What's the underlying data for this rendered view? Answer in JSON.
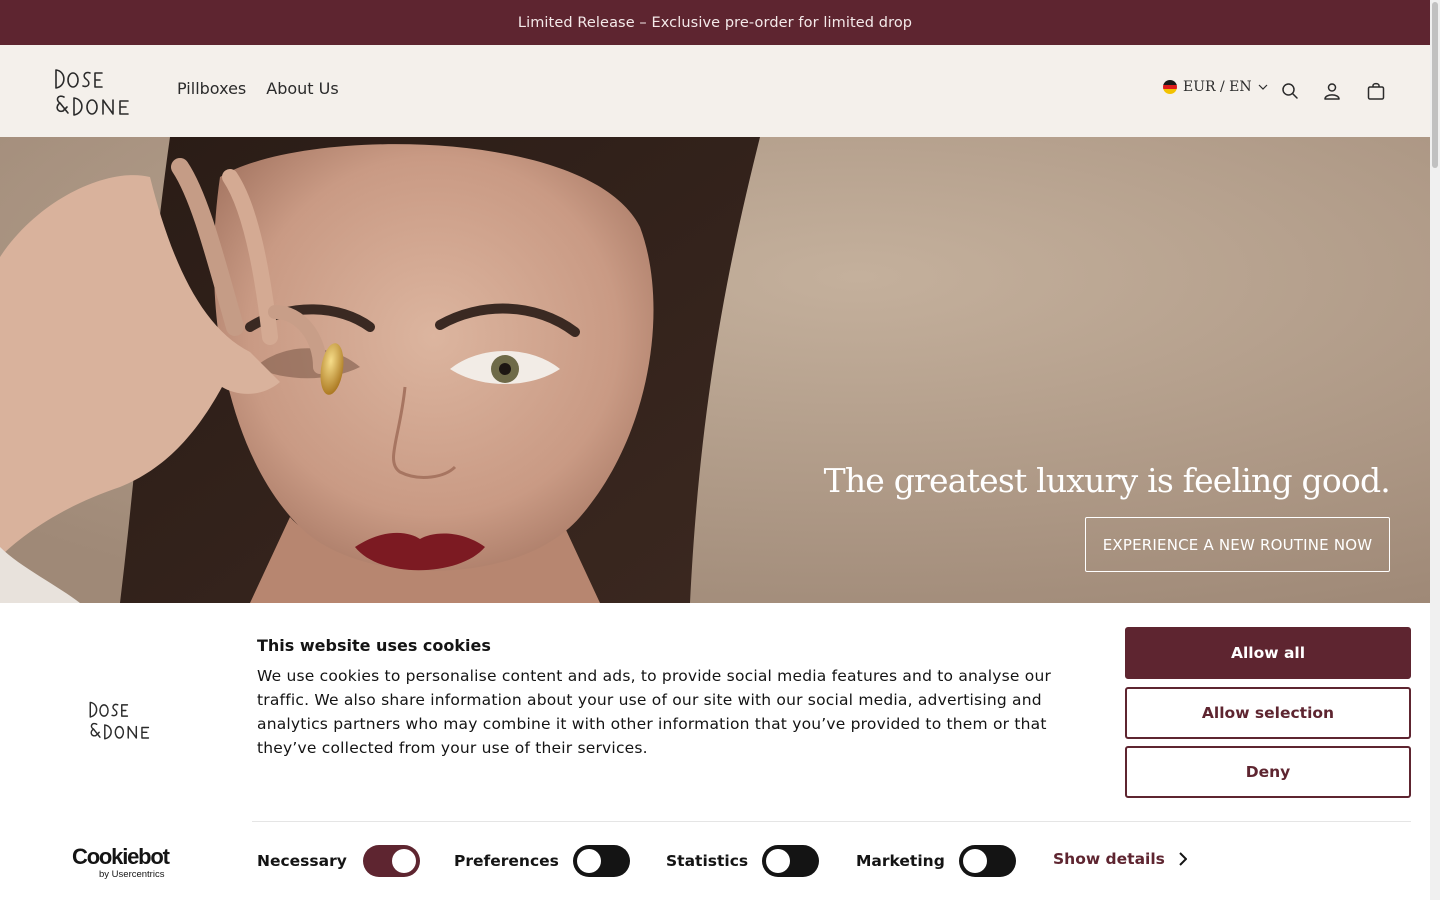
{
  "announcement": {
    "text": "Limited Release – Exclusive pre-order for limited drop"
  },
  "header": {
    "logo_text": "DOSE & DONE",
    "nav": [
      {
        "label": "Pillboxes"
      },
      {
        "label": "About Us"
      }
    ],
    "locale_label": "EUR / EN",
    "icons": [
      "germany-flag-icon",
      "chevron-down-icon",
      "search-icon",
      "account-icon",
      "cart-icon"
    ]
  },
  "hero": {
    "headline": "The greatest luxury is feeling good.",
    "cta": "EXPERIENCE A NEW ROUTINE NOW"
  },
  "cookie": {
    "title": "This website uses cookies",
    "body": "We use cookies to personalise content and ads, to provide social media features and to analyse our traffic. We also share information about your use of our site with our social media, advertising and analytics partners who may combine it with other information that you’ve provided to them or that they’ve collected from your use of their services.",
    "buttons": {
      "allow_all": "Allow all",
      "allow_selection": "Allow selection",
      "deny": "Deny"
    },
    "toggles": [
      {
        "label": "Necessary",
        "checked": true
      },
      {
        "label": "Preferences",
        "checked": false
      },
      {
        "label": "Statistics",
        "checked": false
      },
      {
        "label": "Marketing",
        "checked": false
      }
    ],
    "show_details": "Show details",
    "brand": {
      "name": "Cookiebot",
      "sub": "by Usercentrics"
    }
  },
  "colors": {
    "brand": "#5e2530",
    "header_bg": "#f4f0eb",
    "text": "#141414"
  }
}
